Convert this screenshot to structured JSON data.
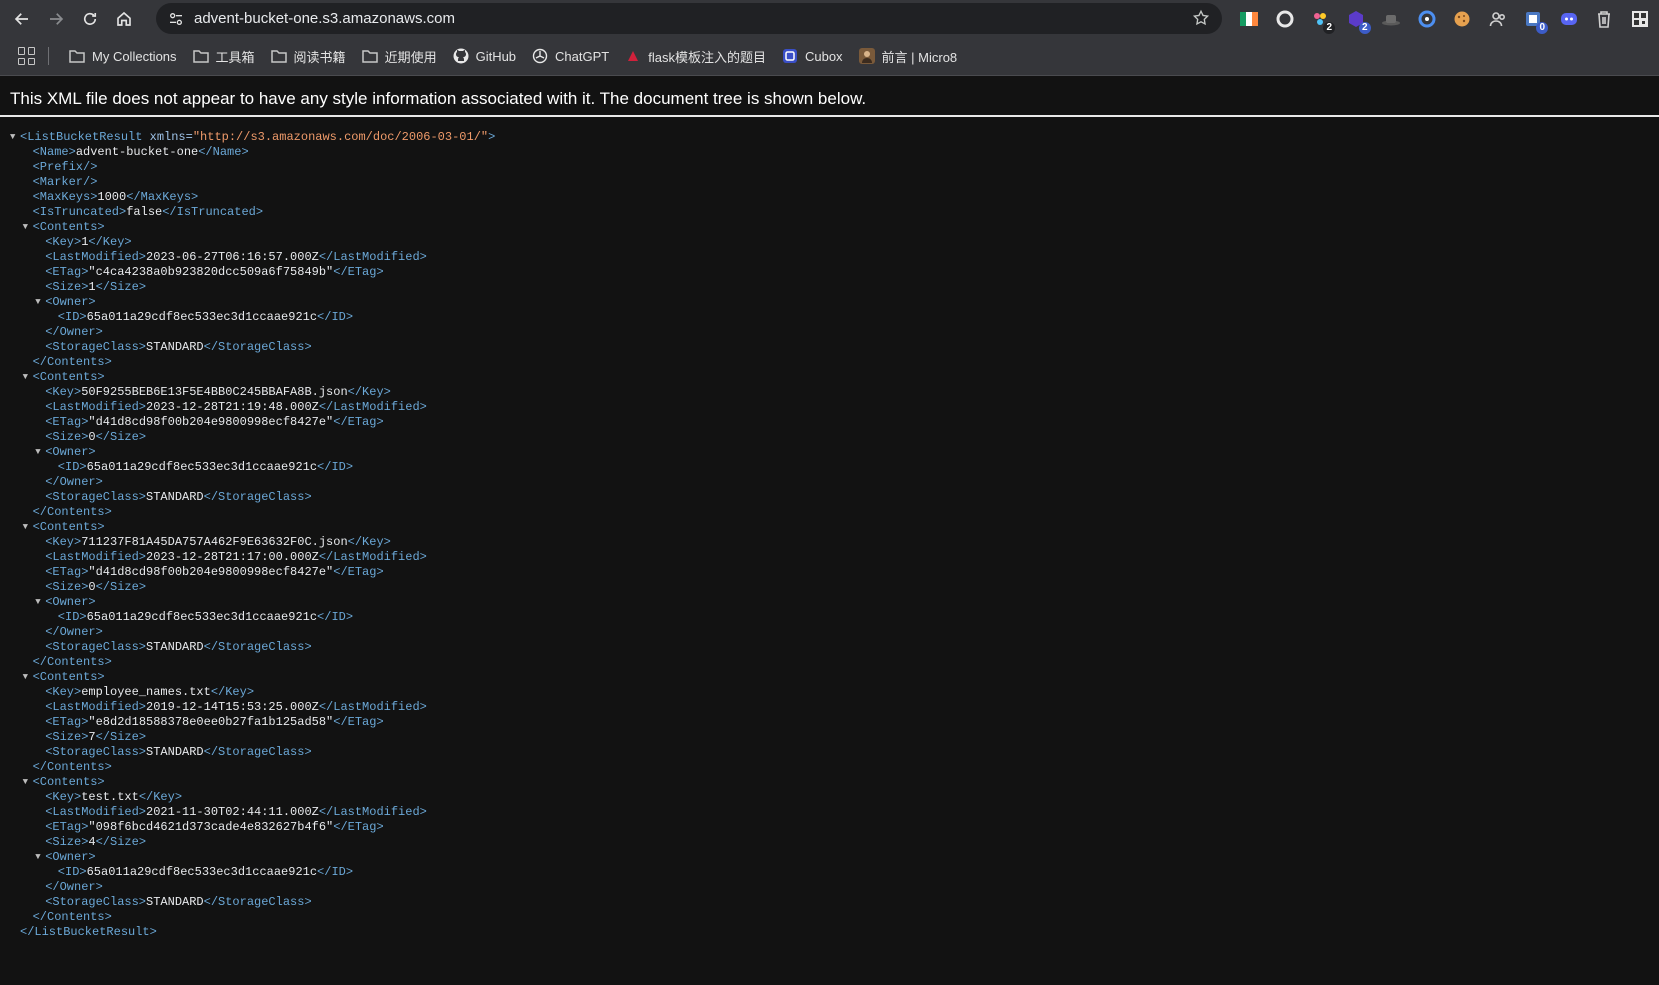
{
  "browser": {
    "url": "advent-bucket-one.s3.amazonaws.com",
    "extensions": [
      {
        "name": "flag-icon",
        "badge": ""
      },
      {
        "name": "circle-icon",
        "badge": ""
      },
      {
        "name": "paint-icon",
        "badge": "2"
      },
      {
        "name": "purple-icon",
        "badge": "2"
      },
      {
        "name": "hat-icon",
        "badge": ""
      },
      {
        "name": "refresh-ext-icon",
        "badge": ""
      },
      {
        "name": "cookie-icon",
        "badge": ""
      },
      {
        "name": "people-icon",
        "badge": ""
      },
      {
        "name": "ext-square-icon",
        "badge": "0"
      },
      {
        "name": "discord-icon",
        "badge": ""
      },
      {
        "name": "trash-icon",
        "badge": ""
      },
      {
        "name": "qr-icon",
        "badge": ""
      }
    ]
  },
  "bookmarks": [
    {
      "label": "My Collections",
      "icon": "folder-icon"
    },
    {
      "label": "工具箱",
      "icon": "folder-icon"
    },
    {
      "label": "阅读书籍",
      "icon": "folder-icon"
    },
    {
      "label": "近期使用",
      "icon": "folder-icon"
    },
    {
      "label": "GitHub",
      "icon": "github-icon"
    },
    {
      "label": "ChatGPT",
      "icon": "chatgpt-icon"
    },
    {
      "label": "flask模板注入的题目",
      "icon": "flask-icon"
    },
    {
      "label": "Cubox",
      "icon": "cubox-icon"
    },
    {
      "label": "前言 | Micro8",
      "icon": "avatar-icon"
    }
  ],
  "page": {
    "info": "This XML file does not appear to have any style information associated with it. The document tree is shown below.",
    "tree": [
      {
        "indent": 0,
        "fold": "▼",
        "open": "<ListBucketResult",
        "attr": " xmlns=",
        "val": "\"http://s3.amazonaws.com/doc/2006-03-01/\"",
        "close": ">"
      },
      {
        "indent": 1,
        "open": "<Name>",
        "text": "advent-bucket-one",
        "close": "</Name>"
      },
      {
        "indent": 1,
        "open": "<Prefix/>"
      },
      {
        "indent": 1,
        "open": "<Marker/>"
      },
      {
        "indent": 1,
        "open": "<MaxKeys>",
        "text": "1000",
        "close": "</MaxKeys>"
      },
      {
        "indent": 1,
        "open": "<IsTruncated>",
        "text": "false",
        "close": "</IsTruncated>"
      },
      {
        "indent": 1,
        "fold": "▼",
        "open": "<Contents>"
      },
      {
        "indent": 2,
        "open": "<Key>",
        "text": "1",
        "close": "</Key>"
      },
      {
        "indent": 2,
        "open": "<LastModified>",
        "text": "2023-06-27T06:16:57.000Z",
        "close": "</LastModified>"
      },
      {
        "indent": 2,
        "open": "<ETag>",
        "text": "\"c4ca4238a0b923820dcc509a6f75849b\"",
        "close": "</ETag>"
      },
      {
        "indent": 2,
        "open": "<Size>",
        "text": "1",
        "close": "</Size>"
      },
      {
        "indent": 2,
        "fold": "▼",
        "open": "<Owner>"
      },
      {
        "indent": 3,
        "open": "<ID>",
        "text": "65a011a29cdf8ec533ec3d1ccaae921c",
        "close": "</ID>"
      },
      {
        "indent": 2,
        "open": "</Owner>"
      },
      {
        "indent": 2,
        "open": "<StorageClass>",
        "text": "STANDARD",
        "close": "</StorageClass>"
      },
      {
        "indent": 1,
        "open": "</Contents>"
      },
      {
        "indent": 1,
        "fold": "▼",
        "open": "<Contents>"
      },
      {
        "indent": 2,
        "open": "<Key>",
        "text": "50F9255BEB6E13F5E4BB0C245BBAFA8B.json",
        "close": "</Key>"
      },
      {
        "indent": 2,
        "open": "<LastModified>",
        "text": "2023-12-28T21:19:48.000Z",
        "close": "</LastModified>"
      },
      {
        "indent": 2,
        "open": "<ETag>",
        "text": "\"d41d8cd98f00b204e9800998ecf8427e\"",
        "close": "</ETag>"
      },
      {
        "indent": 2,
        "open": "<Size>",
        "text": "0",
        "close": "</Size>"
      },
      {
        "indent": 2,
        "fold": "▼",
        "open": "<Owner>"
      },
      {
        "indent": 3,
        "open": "<ID>",
        "text": "65a011a29cdf8ec533ec3d1ccaae921c",
        "close": "</ID>"
      },
      {
        "indent": 2,
        "open": "</Owner>"
      },
      {
        "indent": 2,
        "open": "<StorageClass>",
        "text": "STANDARD",
        "close": "</StorageClass>"
      },
      {
        "indent": 1,
        "open": "</Contents>"
      },
      {
        "indent": 1,
        "fold": "▼",
        "open": "<Contents>"
      },
      {
        "indent": 2,
        "open": "<Key>",
        "text": "711237F81A45DA757A462F9E63632F0C.json",
        "close": "</Key>"
      },
      {
        "indent": 2,
        "open": "<LastModified>",
        "text": "2023-12-28T21:17:00.000Z",
        "close": "</LastModified>"
      },
      {
        "indent": 2,
        "open": "<ETag>",
        "text": "\"d41d8cd98f00b204e9800998ecf8427e\"",
        "close": "</ETag>"
      },
      {
        "indent": 2,
        "open": "<Size>",
        "text": "0",
        "close": "</Size>"
      },
      {
        "indent": 2,
        "fold": "▼",
        "open": "<Owner>"
      },
      {
        "indent": 3,
        "open": "<ID>",
        "text": "65a011a29cdf8ec533ec3d1ccaae921c",
        "close": "</ID>"
      },
      {
        "indent": 2,
        "open": "</Owner>"
      },
      {
        "indent": 2,
        "open": "<StorageClass>",
        "text": "STANDARD",
        "close": "</StorageClass>"
      },
      {
        "indent": 1,
        "open": "</Contents>"
      },
      {
        "indent": 1,
        "fold": "▼",
        "open": "<Contents>"
      },
      {
        "indent": 2,
        "open": "<Key>",
        "text": "employee_names.txt",
        "close": "</Key>"
      },
      {
        "indent": 2,
        "open": "<LastModified>",
        "text": "2019-12-14T15:53:25.000Z",
        "close": "</LastModified>"
      },
      {
        "indent": 2,
        "open": "<ETag>",
        "text": "\"e8d2d18588378e0ee0b27fa1b125ad58\"",
        "close": "</ETag>"
      },
      {
        "indent": 2,
        "open": "<Size>",
        "text": "7",
        "close": "</Size>"
      },
      {
        "indent": 2,
        "open": "<StorageClass>",
        "text": "STANDARD",
        "close": "</StorageClass>"
      },
      {
        "indent": 1,
        "open": "</Contents>"
      },
      {
        "indent": 1,
        "fold": "▼",
        "open": "<Contents>"
      },
      {
        "indent": 2,
        "open": "<Key>",
        "text": "test.txt",
        "close": "</Key>"
      },
      {
        "indent": 2,
        "open": "<LastModified>",
        "text": "2021-11-30T02:44:11.000Z",
        "close": "</LastModified>"
      },
      {
        "indent": 2,
        "open": "<ETag>",
        "text": "\"098f6bcd4621d373cade4e832627b4f6\"",
        "close": "</ETag>"
      },
      {
        "indent": 2,
        "open": "<Size>",
        "text": "4",
        "close": "</Size>"
      },
      {
        "indent": 2,
        "fold": "▼",
        "open": "<Owner>"
      },
      {
        "indent": 3,
        "open": "<ID>",
        "text": "65a011a29cdf8ec533ec3d1ccaae921c",
        "close": "</ID>"
      },
      {
        "indent": 2,
        "open": "</Owner>"
      },
      {
        "indent": 2,
        "open": "<StorageClass>",
        "text": "STANDARD",
        "close": "</StorageClass>"
      },
      {
        "indent": 1,
        "open": "</Contents>"
      },
      {
        "indent": 0,
        "open": "</ListBucketResult>"
      }
    ]
  }
}
